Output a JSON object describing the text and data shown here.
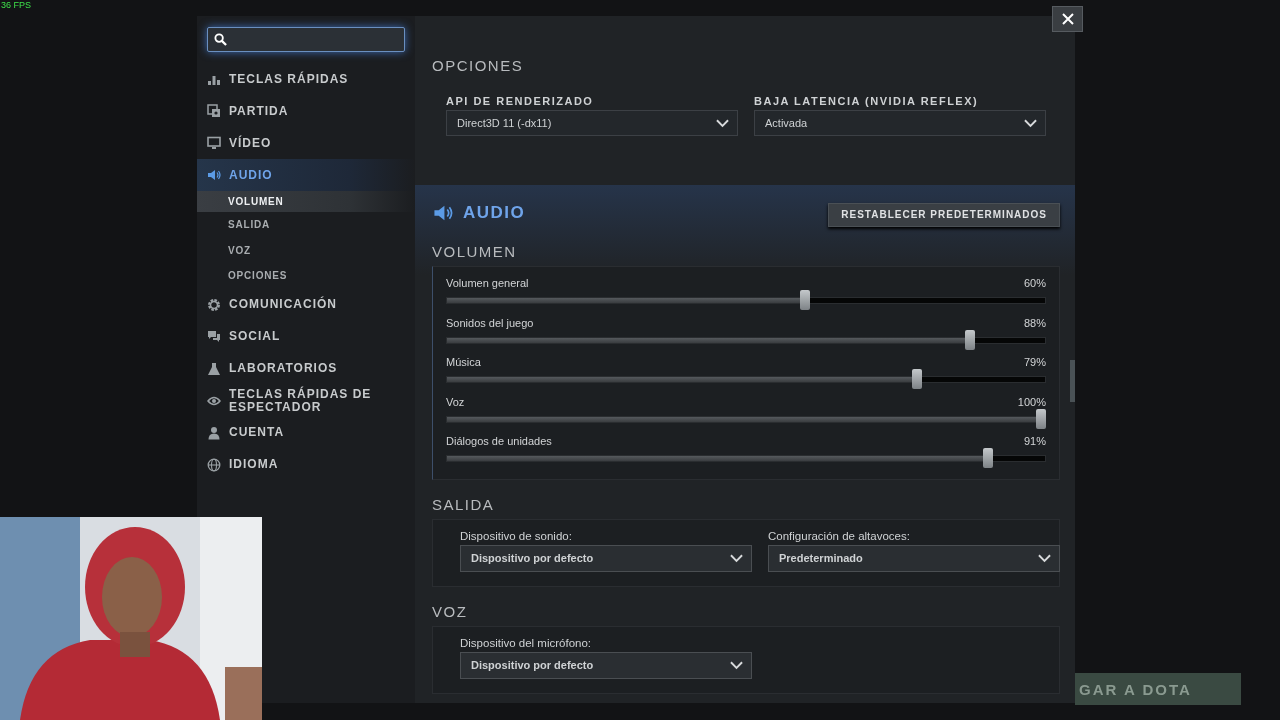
{
  "fps_counter": "36 FPS",
  "background_button": "GAR A DOTA",
  "nav": [
    {
      "label": "TECLAS RÁPIDAS",
      "selected": false
    },
    {
      "label": "PARTIDA",
      "selected": false
    },
    {
      "label": "VÍDEO",
      "selected": false
    },
    {
      "label": "AUDIO",
      "selected": true,
      "children": [
        {
          "label": "VOLUMEN",
          "selected": true
        },
        {
          "label": "SALIDA",
          "selected": false
        },
        {
          "label": "VOZ",
          "selected": false
        },
        {
          "label": "OPCIONES",
          "selected": false
        }
      ]
    },
    {
      "label": "COMUNICACIÓN",
      "selected": false
    },
    {
      "label": "SOCIAL",
      "selected": false
    },
    {
      "label": "LABORATORIOS",
      "selected": false
    },
    {
      "label": "TECLAS RÁPIDAS DE ESPECTADOR",
      "selected": false
    },
    {
      "label": "CUENTA",
      "selected": false
    },
    {
      "label": "IDIOMA",
      "selected": false
    }
  ],
  "video_options": {
    "heading": "OPCIONES",
    "fields": [
      {
        "label": "API DE RENDERIZADO",
        "value": "Direct3D 11 (-dx11)"
      },
      {
        "label": "BAJA LATENCIA (NVIDIA REFLEX)",
        "value": "Activada"
      }
    ]
  },
  "audio": {
    "title": "AUDIO",
    "reset_button": "RESTABLECER PREDETERMINADOS",
    "sections": [
      {
        "heading": "VOLUMEN",
        "kind": "sliders",
        "sliders": [
          {
            "label": "Volumen general",
            "reading": "60%",
            "level": 0.6
          },
          {
            "label": "Sonidos del juego",
            "reading": "88%",
            "level": 0.88
          },
          {
            "label": "Música",
            "reading": "79%",
            "level": 0.79
          },
          {
            "label": "Voz",
            "reading": "100%",
            "level": 1
          },
          {
            "label": "Diálogos de unidades",
            "reading": "91%",
            "level": 0.91
          }
        ]
      },
      {
        "heading": "SALIDA",
        "kind": "dropdowns",
        "fields": [
          {
            "label": "Dispositivo de sonido:",
            "value": "Dispositivo por defecto"
          },
          {
            "label": "Configuración de altavoces:",
            "value": "Predeterminado"
          }
        ]
      },
      {
        "heading": "VOZ",
        "kind": "dropdowns",
        "fields": [
          {
            "label": "Dispositivo del micrófono:",
            "value": "Dispositivo por defecto"
          }
        ]
      }
    ]
  }
}
